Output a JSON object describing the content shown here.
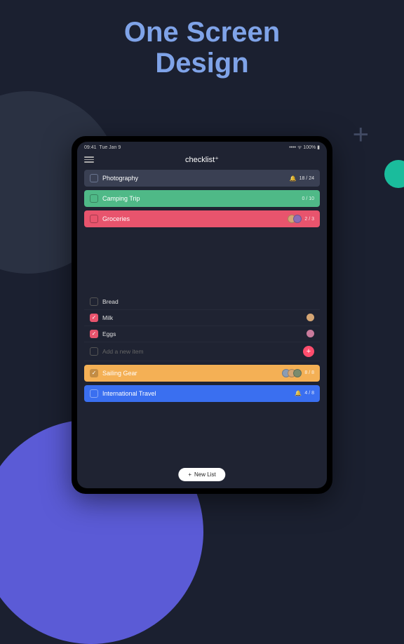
{
  "headline_line1": "One Screen",
  "headline_line2": "Design",
  "status": {
    "time": "09:41",
    "date": "Tue Jan 9",
    "battery": "100%"
  },
  "app_title": "checklist⁺",
  "lists": [
    {
      "title": "Photography",
      "counter": "18 / 24",
      "color": "#3a4053",
      "bell": true
    },
    {
      "title": "Camping Trip",
      "counter": "0 / 10",
      "color": "#4fb987"
    },
    {
      "title": "Groceries",
      "counter": "2 / 3",
      "color": "#e8546d",
      "avatars": 2
    },
    {
      "title": "Sailing Gear",
      "counter": "8 / 8",
      "color": "#f4b055",
      "avatars": 3,
      "checked": true
    },
    {
      "title": "International Travel",
      "counter": "4 / 8",
      "color": "#3a6ff0",
      "bell": true
    }
  ],
  "items": [
    {
      "text": "Bread",
      "checked": false
    },
    {
      "text": "Milk",
      "checked": true,
      "avatar": true
    },
    {
      "text": "Eggs",
      "checked": true,
      "avatar": true
    }
  ],
  "add_placeholder": "Add a new item",
  "new_list_label": "New List"
}
